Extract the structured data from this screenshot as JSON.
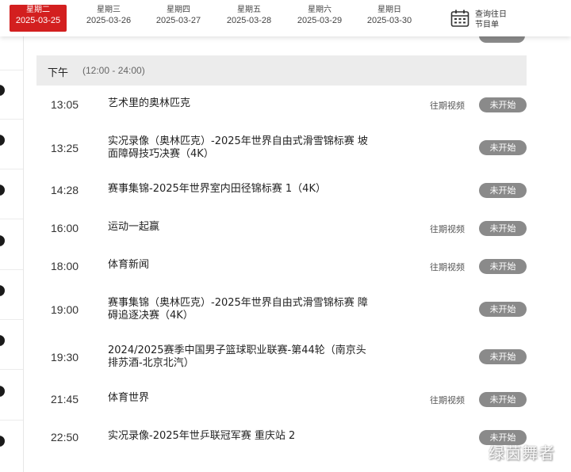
{
  "date_tabs": [
    {
      "weekday": "星期二",
      "date": "2025-03-25",
      "active": true
    },
    {
      "weekday": "星期三",
      "date": "2025-03-26",
      "active": false
    },
    {
      "weekday": "星期四",
      "date": "2025-03-27",
      "active": false
    },
    {
      "weekday": "星期五",
      "date": "2025-03-28",
      "active": false
    },
    {
      "weekday": "星期六",
      "date": "2025-03-29",
      "active": false
    },
    {
      "weekday": "星期日",
      "date": "2025-03-30",
      "active": false
    }
  ],
  "history": {
    "line1": "查询往日",
    "line2": "节目单",
    "icon": "calendar-icon"
  },
  "section": {
    "title": "下午",
    "range": "(12:00 - 24:00)"
  },
  "programs": [
    {
      "time": "13:05",
      "title": "艺术里的奥林匹克",
      "replay": "往期视频",
      "status": "未开始"
    },
    {
      "time": "13:25",
      "title": "实况录像（奥林匹克）-2025年世界自由式滑雪锦标赛 坡面障碍技巧决赛（4K）",
      "replay": "",
      "status": "未开始"
    },
    {
      "time": "14:28",
      "title": "赛事集锦-2025年世界室内田径锦标赛 1（4K）",
      "replay": "",
      "status": "未开始"
    },
    {
      "time": "16:00",
      "title": "运动一起赢",
      "replay": "往期视频",
      "status": "未开始"
    },
    {
      "time": "18:00",
      "title": "体育新闻",
      "replay": "往期视频",
      "status": "未开始"
    },
    {
      "time": "19:00",
      "title": "赛事集锦（奥林匹克）-2025年世界自由式滑雪锦标赛 障碍追逐决赛（4K）",
      "replay": "",
      "status": "未开始"
    },
    {
      "time": "19:30",
      "title": "2024/2025赛季中国男子篮球职业联赛-第44轮（南京头排苏酒-北京北汽）",
      "replay": "",
      "status": "未开始"
    },
    {
      "time": "21:45",
      "title": "体育世界",
      "replay": "往期视频",
      "status": "未开始"
    },
    {
      "time": "22:50",
      "title": "实况录像-2025年世乒联冠军赛 重庆站 2",
      "replay": "",
      "status": "未开始"
    }
  ],
  "watermark": "绿茵舞者",
  "colors": {
    "accent": "#d31f1f",
    "badge": "#8a8a8a",
    "section_bg": "#ececec"
  }
}
